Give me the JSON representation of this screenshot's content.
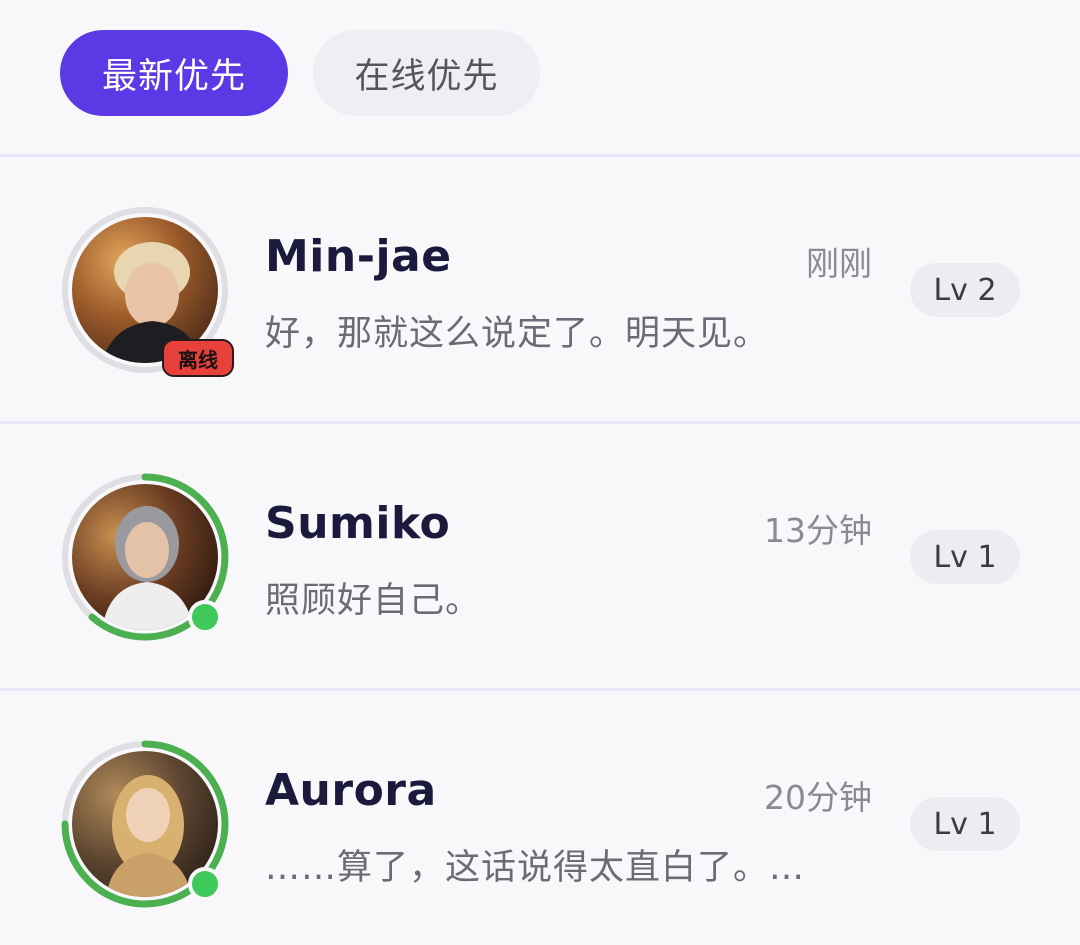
{
  "filters": {
    "active_label": "最新优先",
    "inactive_label": "在线优先"
  },
  "conversations": [
    {
      "name": "Min-jae",
      "time": "刚刚",
      "preview": "好，那就这么说定了。明天见。",
      "level": "Lv 2",
      "status": "离线",
      "online": false
    },
    {
      "name": "Sumiko",
      "time": "13分钟",
      "preview": "照顾好自己。",
      "level": "Lv 1",
      "online": true
    },
    {
      "name": "Aurora",
      "time": "20分钟",
      "preview": "……算了，这话说得太直白了。…",
      "level": "Lv 1",
      "online": true
    }
  ],
  "colors": {
    "accent": "#5b3ae6",
    "online": "#3fc95a",
    "offline_badge": "#e8413b",
    "divider": "#e6e7fb"
  }
}
